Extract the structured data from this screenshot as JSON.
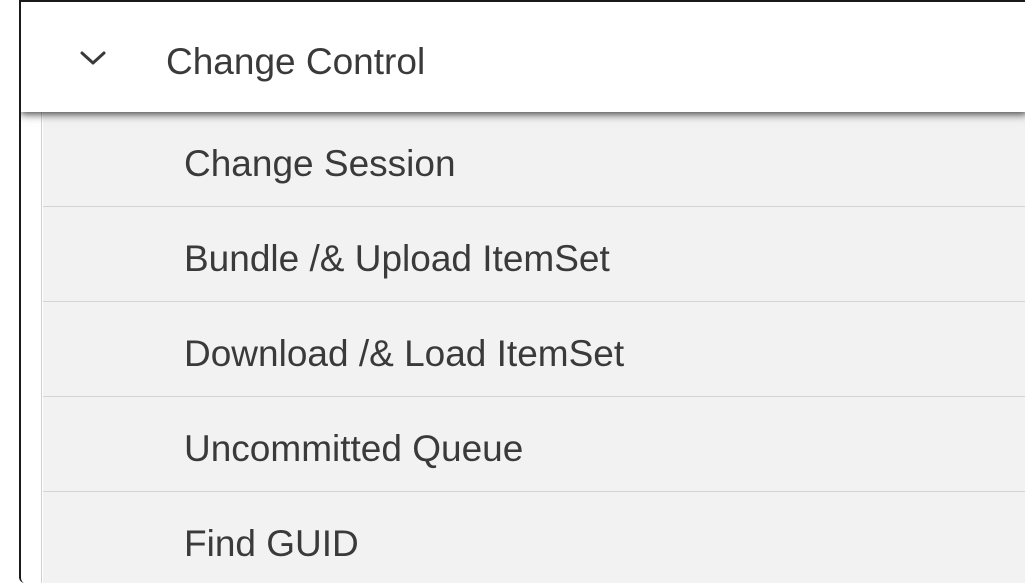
{
  "menu": {
    "title": "Change Control",
    "expanded_icon": "chevron-down-icon",
    "items": [
      {
        "label": "Change Session"
      },
      {
        "label": "Bundle /& Upload ItemSet"
      },
      {
        "label": "Download /& Load ItemSet"
      },
      {
        "label": "Uncommitted Queue"
      },
      {
        "label": "Find GUID"
      }
    ]
  },
  "colors": {
    "header_bg": "#ffffff",
    "item_bg": "#f2f2f2",
    "divider": "#d4d4d4",
    "text": "#3a3a3a"
  }
}
